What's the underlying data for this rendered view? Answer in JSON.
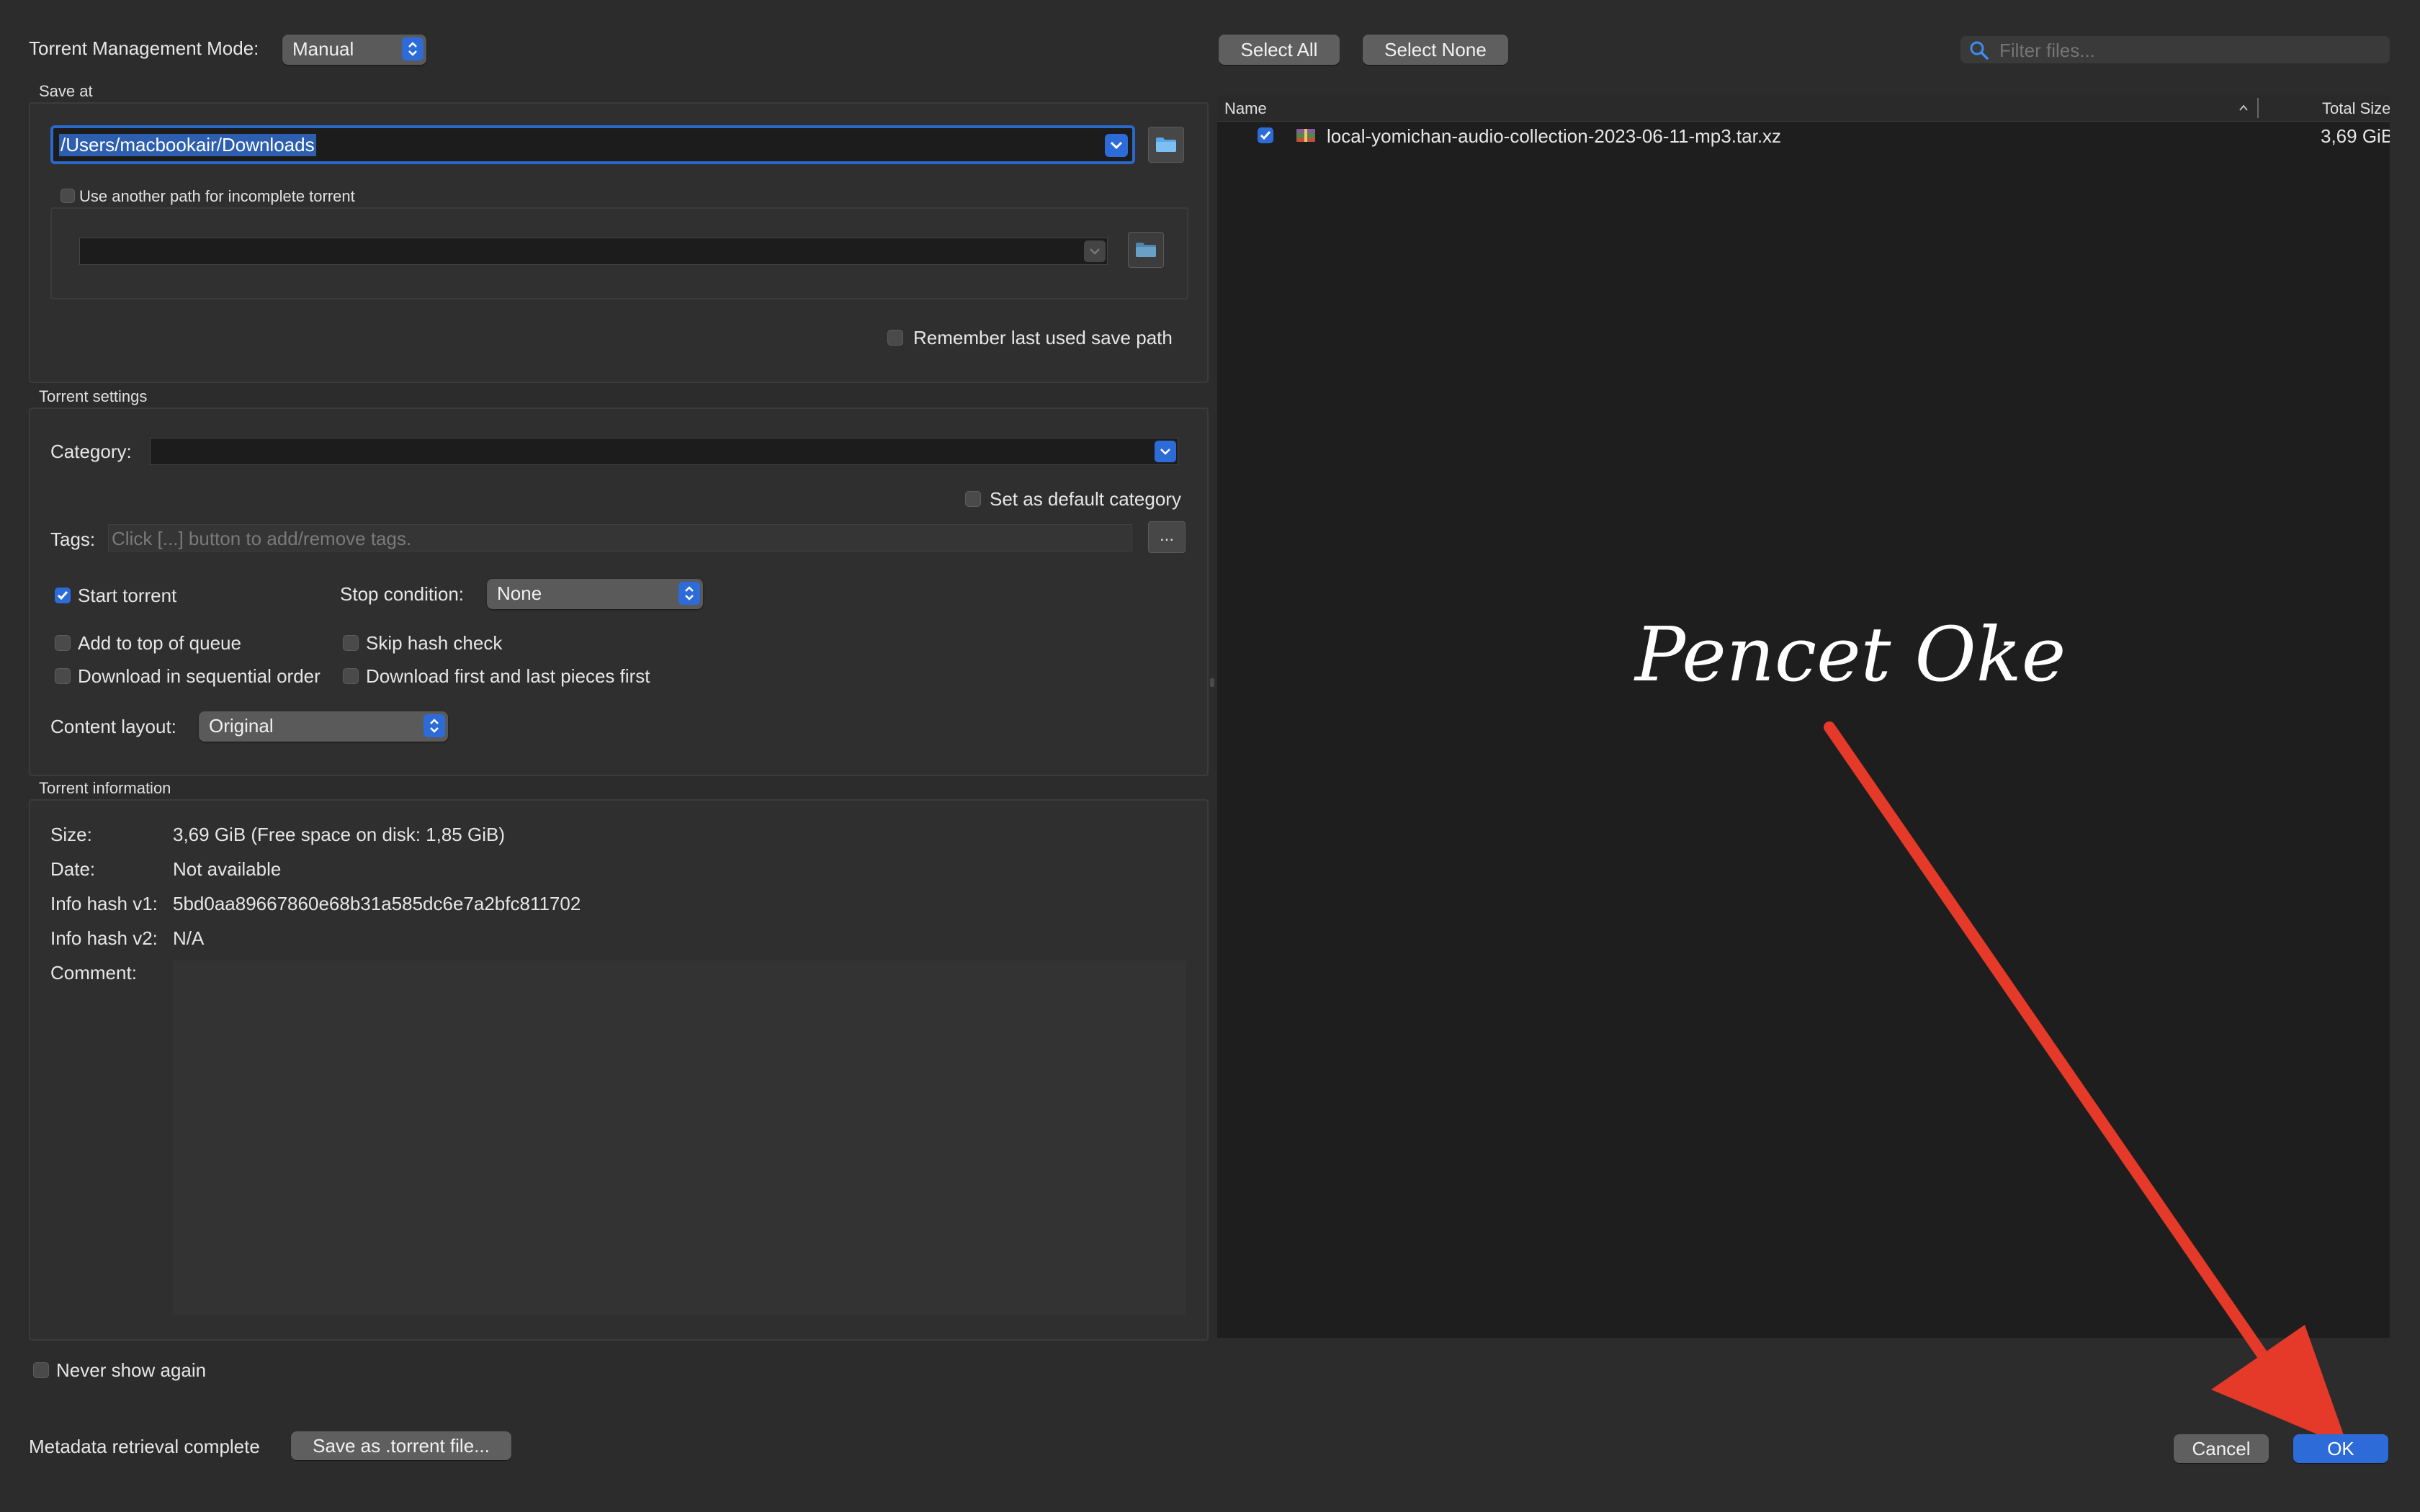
{
  "top": {
    "mode_label": "Torrent Management Mode:",
    "mode_value": "Manual",
    "select_all": "Select All",
    "select_none": "Select None",
    "filter_placeholder": "Filter files..."
  },
  "save_at": {
    "title": "Save at",
    "path": "/Users/macbookair/Downloads",
    "use_another_path": "Use another path for incomplete torrent",
    "use_another_path_checked": false,
    "incomplete_path": "",
    "remember_last": "Remember last used save path",
    "remember_last_checked": false
  },
  "torrent_settings": {
    "title": "Torrent settings",
    "category_label": "Category:",
    "category_value": "",
    "default_category": "Set as default category",
    "tags_label": "Tags:",
    "tags_placeholder": "Click [...] button to add/remove tags.",
    "tags_button": "...",
    "start_torrent": "Start torrent",
    "start_torrent_checked": true,
    "stop_condition_label": "Stop condition:",
    "stop_condition_value": "None",
    "add_top_queue": "Add to top of queue",
    "skip_hash": "Skip hash check",
    "sequential": "Download in sequential order",
    "first_last": "Download first and last pieces first",
    "content_layout_label": "Content layout:",
    "content_layout_value": "Original"
  },
  "torrent_info": {
    "title": "Torrent information",
    "size_label": "Size:",
    "size_value": "3,69 GiB (Free space on disk: 1,85 GiB)",
    "date_label": "Date:",
    "date_value": "Not available",
    "hash1_label": "Info hash v1:",
    "hash1_value": "5bd0aa89667860e68b31a585dc6e7a2bfc811702",
    "hash2_label": "Info hash v2:",
    "hash2_value": "N/A",
    "comment_label": "Comment:",
    "comment_value": ""
  },
  "files": {
    "col_name": "Name",
    "col_size": "Total Size",
    "rows": [
      {
        "name": "local-yomichan-audio-collection-2023-06-11-mp3.tar.xz",
        "size": "3,69 GiB",
        "checked": true
      }
    ]
  },
  "annotation": {
    "text": "Pencet Oke",
    "arrow_color": "#e5392a"
  },
  "bottom": {
    "never_show": "Never show again",
    "status": "Metadata retrieval complete",
    "save_torrent": "Save as .torrent file...",
    "cancel": "Cancel",
    "ok": "OK"
  },
  "colors": {
    "accent": "#2d6bd8",
    "background": "#2c2c2c",
    "file_list_bg": "#1e1e1e"
  }
}
